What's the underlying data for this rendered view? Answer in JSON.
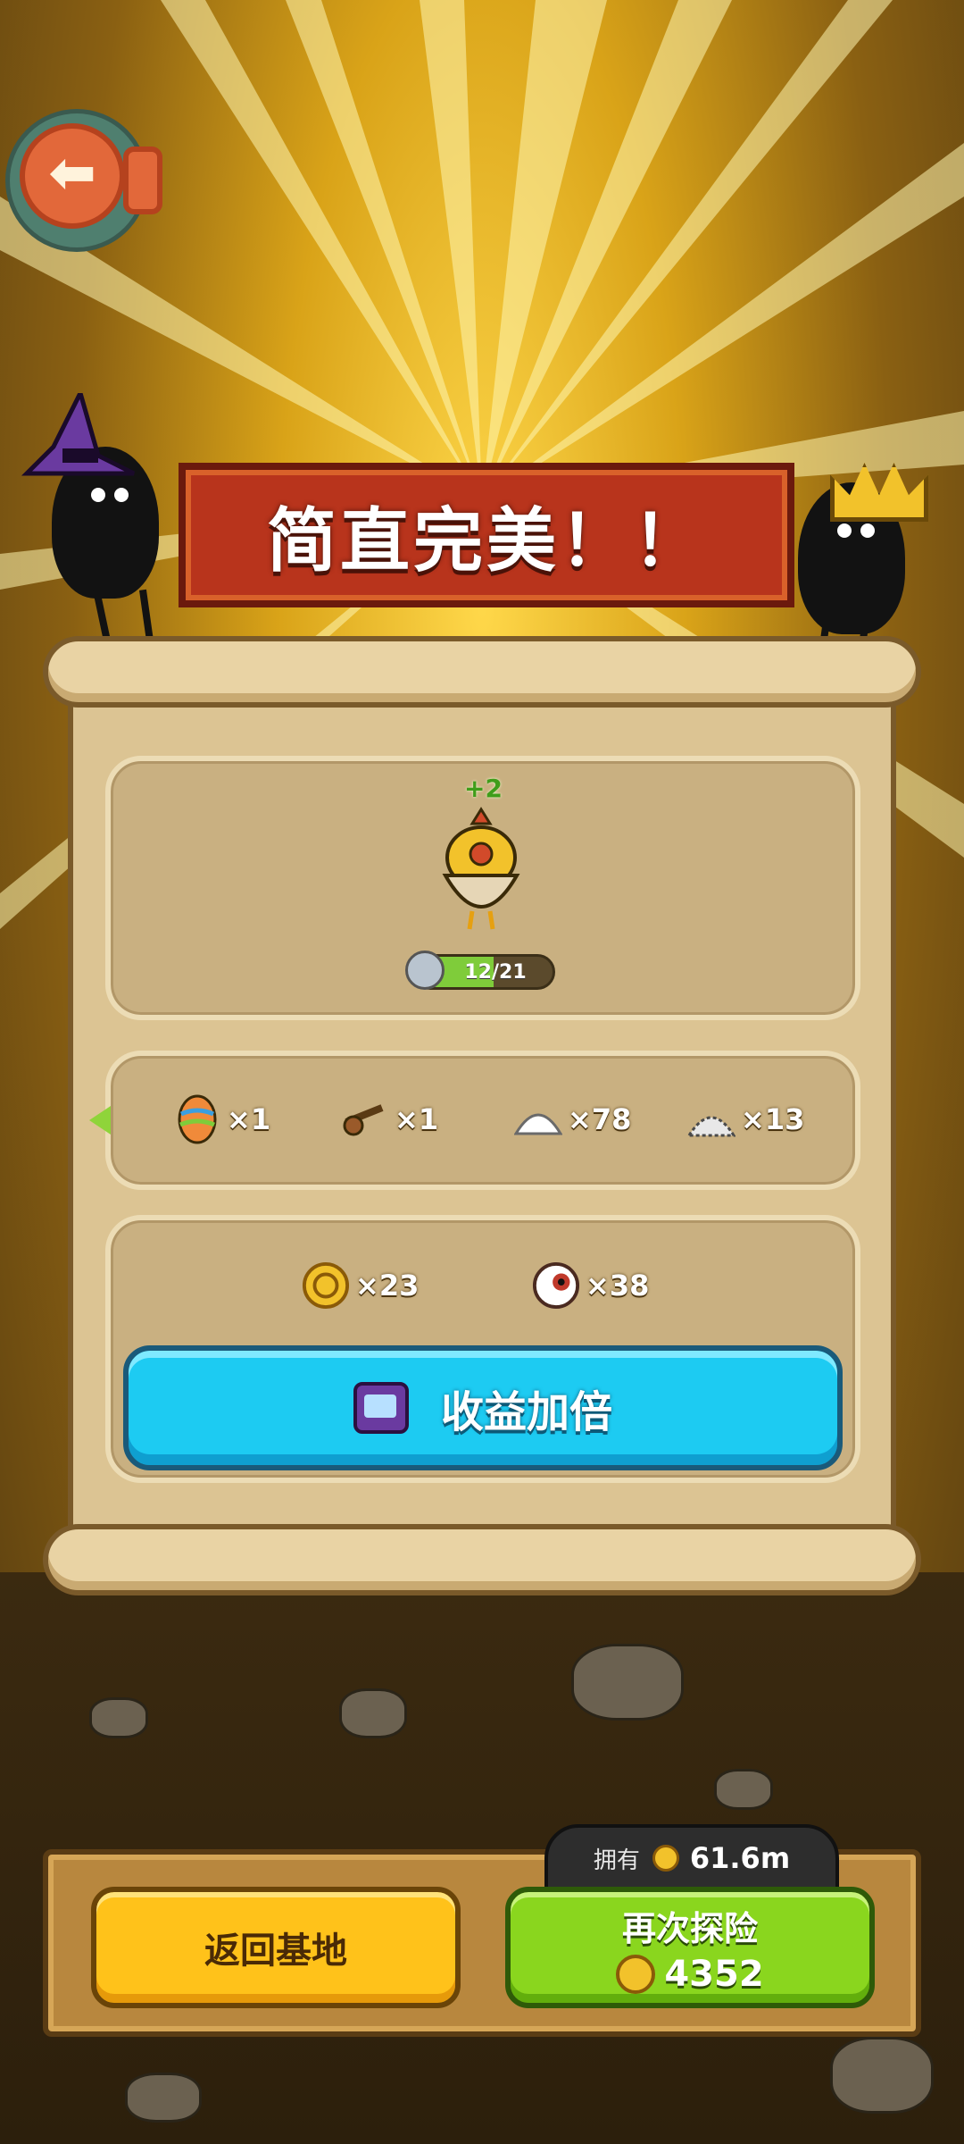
{
  "header": {
    "back_icon": "back-arrow-icon"
  },
  "banner": {
    "title": "简直完美！！"
  },
  "pet": {
    "plus": "+2",
    "level_text": "12/21",
    "level_progress": 0.571
  },
  "loot_row": [
    {
      "name": "rainbow-egg-icon",
      "qty": "×1",
      "color": "#f08a3a"
    },
    {
      "name": "slingshot-icon",
      "qty": "×1",
      "color": "#9a5a2a"
    },
    {
      "name": "salt-pile-icon",
      "qty": "×78",
      "color": "#ffffff"
    },
    {
      "name": "stone-pile-icon",
      "qty": "×13",
      "color": "#e8e8e8"
    }
  ],
  "rewards": [
    {
      "name": "coin-icon",
      "qty": "×23",
      "color": "#f2c22b"
    },
    {
      "name": "eyeball-icon",
      "qty": "×38",
      "color": "#ffffff"
    }
  ],
  "double_button": {
    "label": "收益加倍",
    "icon": "tv-icon"
  },
  "footer": {
    "own_label": "拥有",
    "own_value": "61.6m",
    "home_button": "返回基地",
    "again_button": "再次探险",
    "again_cost": "4352"
  },
  "colors": {
    "accent_blue": "#1dcbf2",
    "accent_green": "#8ad61e",
    "accent_yellow": "#ffc21a",
    "banner_red": "#b8341c"
  }
}
